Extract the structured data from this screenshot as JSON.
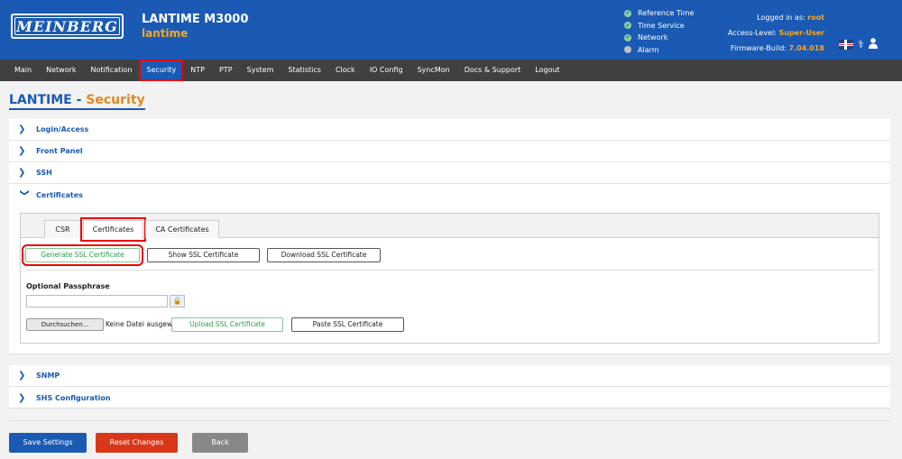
{
  "header": {
    "logo_text": "MEINBERG",
    "device_name": "LANTIME M3000",
    "hostname": "lantime",
    "status": [
      {
        "label": "Reference Time",
        "state": "ok"
      },
      {
        "label": "Time Service",
        "state": "ok"
      },
      {
        "label": "Network",
        "state": "ok"
      },
      {
        "label": "Alarm",
        "state": "inactive"
      }
    ],
    "logged_in_label": "Logged in as:",
    "logged_in_value": "root",
    "access_label": "Access-Level:",
    "access_value": "Super-User",
    "firmware_label": "Firmware-Build:",
    "firmware_value": "7.04.018",
    "icons": [
      "uk-flag-icon",
      "stethoscope-icon",
      "user-icon"
    ]
  },
  "nav": {
    "items": [
      "Main",
      "Network",
      "Notification",
      "Security",
      "NTP",
      "PTP",
      "System",
      "Statistics",
      "Clock",
      "IO Config",
      "SyncMon",
      "Docs & Support",
      "Logout"
    ],
    "active": "Security"
  },
  "page": {
    "title_prefix": "LANTIME - ",
    "title_section": "Security"
  },
  "sections_top": [
    "Login/Access",
    "Front Panel",
    "SSH",
    "Certificates"
  ],
  "sections_bottom": [
    "SNMP",
    "SHS Configuration"
  ],
  "certificates": {
    "tabs": [
      "CSR",
      "Certificates",
      "CA Certificates"
    ],
    "active_tab": "Certificates",
    "generate_label": "Generate SSL Certificate",
    "show_label": "Show SSL Certificate",
    "download_label": "Download SSL Certificate",
    "passphrase_label": "Optional Passphrase",
    "passphrase_value": "",
    "browse_label": "Durchsuchen...",
    "no_file_label": "Keine Datei ausgewählt.",
    "upload_label": "Upload SSL Certificate",
    "paste_label": "Paste SSL Certificate"
  },
  "footer": {
    "save_label": "Save Settings",
    "reset_label": "Reset Changes",
    "back_label": "Back"
  },
  "colors": {
    "header_bg": "#1a5ab5",
    "accent_orange": "#f5a623",
    "nav_bg": "#404040",
    "save_btn": "#1a5ab5",
    "reset_btn": "#d9371a",
    "back_btn": "#888888",
    "highlight": "#e00000"
  }
}
